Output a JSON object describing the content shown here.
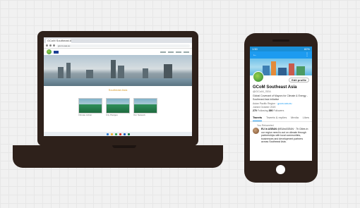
{
  "laptop": {
    "browser_tab_label": "GCoM Southeast Asia",
    "address": "gcom-sea.eu",
    "hero_caption": "Southeast Asia",
    "cards": [
      "Climate Action",
      "City Pledges",
      "Our Network"
    ]
  },
  "phone": {
    "status_time": "1:50",
    "status_battery": "82%",
    "edit_label": "Edit profile",
    "name": "GCoM Southeast Asia",
    "handle": "@GCoM_SEA",
    "bio": "Global Covenant of Mayors for Climate & Energy - Southeast Asia Initiative",
    "location": "Asian Pacific Region",
    "link": "gcom-sea.eu",
    "joined": "Joined October 2020",
    "following_count": "270",
    "following_label": "Following",
    "followers_count": "390",
    "followers_label": "Followers",
    "tabs": [
      "Tweets",
      "Tweets & replies",
      "Media",
      "Likes"
    ],
    "tweet_meta": "You Retweeted",
    "tweet_author": "EU in ASEAN",
    "tweet_handle": "@EUinASEAN · 7h",
    "tweet_text": "Cities in our region need to act on climate through partnerships with local communities, businesses and development partners across Southeast Asia."
  }
}
